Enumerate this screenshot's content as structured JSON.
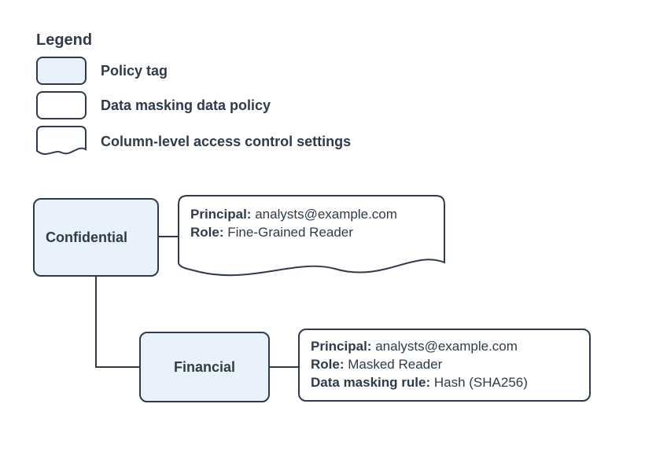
{
  "legend": {
    "title": "Legend",
    "items": [
      {
        "label": "Policy tag"
      },
      {
        "label": "Data masking data policy"
      },
      {
        "label": "Column-level access control settings"
      }
    ]
  },
  "diagram": {
    "tags": {
      "confidential": "Confidential",
      "financial": "Financial"
    },
    "confidential_note": {
      "principal_label": "Principal:",
      "principal_value": "analysts@example.com",
      "role_label": "Role:",
      "role_value": "Fine-Grained Reader"
    },
    "financial_policy": {
      "principal_label": "Principal:",
      "principal_value": "analysts@example.com",
      "role_label": "Role:",
      "role_value": "Masked Reader",
      "rule_label": "Data masking rule:",
      "rule_value": "Hash (SHA256)"
    }
  }
}
